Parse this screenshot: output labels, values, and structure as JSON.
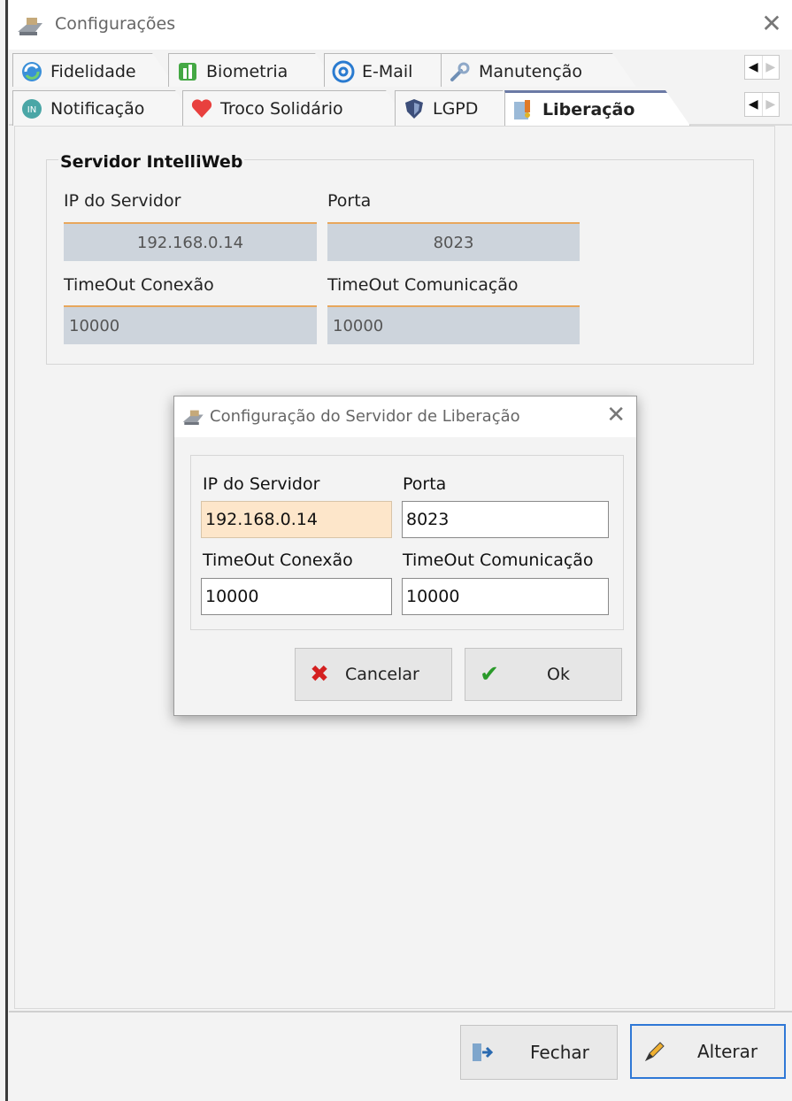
{
  "window": {
    "title": "Configurações"
  },
  "tabs_row1": [
    {
      "label": "Fidelidade",
      "icon": "fidelity-icon"
    },
    {
      "label": "Biometria",
      "icon": "biometry-icon"
    },
    {
      "label": "E-Mail",
      "icon": "at-sign-icon"
    },
    {
      "label": "Manutenção",
      "icon": "wrench-icon"
    }
  ],
  "tabs_row2": [
    {
      "label": "Notificação",
      "icon": "notification-icon"
    },
    {
      "label": "Troco Solidário",
      "icon": "heart-icon"
    },
    {
      "label": "LGPD",
      "icon": "shield-icon"
    },
    {
      "label": "Liberação",
      "icon": "release-icon",
      "active": true
    }
  ],
  "server_group": {
    "title": "Servidor IntelliWeb",
    "ip_label": "IP do Servidor",
    "ip_value": "192.168.0.14",
    "port_label": "Porta",
    "port_value": "8023",
    "timeout_conn_label": "TimeOut Conexão",
    "timeout_conn_value": "10000",
    "timeout_comm_label": "TimeOut Comunicação",
    "timeout_comm_value": "10000"
  },
  "dialog": {
    "title": "Configuração do Servidor de Liberação",
    "ip_label": "IP do Servidor",
    "ip_value": "192.168.0.14",
    "port_label": "Porta",
    "port_value": "8023",
    "timeout_conn_label": "TimeOut Conexão",
    "timeout_conn_value": "10000",
    "timeout_comm_label": "TimeOut Comunicação",
    "timeout_comm_value": "10000",
    "cancel_label": "Cancelar",
    "ok_label": "Ok"
  },
  "footer": {
    "close_label": "Fechar",
    "edit_label": "Alterar"
  },
  "colors": {
    "active_tab_accent": "#6b7aa5",
    "field_accent": "#e8a75c",
    "readonly_bg": "#cdd4dc",
    "focused_bg": "#fde6ca",
    "primary_border": "#2f78d6",
    "cancel_icon": "#d42020",
    "ok_icon": "#2a9a2a"
  }
}
